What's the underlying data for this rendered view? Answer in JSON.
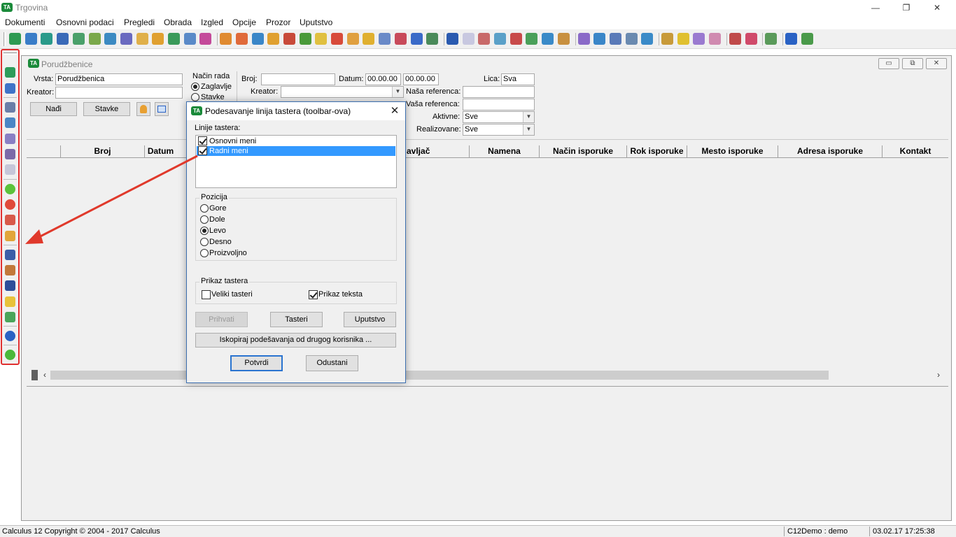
{
  "app": {
    "title": "Trgovina",
    "icon_text": "TA",
    "window_controls": {
      "minimize": "—",
      "restore": "❐",
      "close": "✕"
    }
  },
  "menu": {
    "items": [
      "Dokumenti",
      "Osnovni podaci",
      "Pregledi",
      "Obrada",
      "Izgled",
      "Opcije",
      "Prozor",
      "Uputstvo"
    ]
  },
  "child_window": {
    "title": "Porudžbenice",
    "controls": {
      "minimize": "▭",
      "restore": "⧉",
      "close": "✕"
    },
    "form": {
      "vrsta_label": "Vrsta:",
      "vrsta_value": "Porudžbenica",
      "kreator_label": "Kreator:",
      "kreator_value": "",
      "nadji_button": "Nađi",
      "stavke_button": "Stavke",
      "nacin_rada_label": "Način rada",
      "zaglavlje_label": "Zaglavlje",
      "stavke_radio_label": "Stavke",
      "broj_label": "Broj:",
      "broj_value": "",
      "datum_label": "Datum:",
      "datum_from": "00.00.00",
      "datum_to": "00.00.00",
      "lica_label": "Lica:",
      "lica_value": "Sva",
      "kreator2_label": "Kreator:",
      "kreator2_value": "",
      "nasa_referenca_label": "Naša referenca:",
      "nasa_referenca_value": "",
      "vasa_referenca_label": "Vaša referenca:",
      "vasa_referenca_value": "",
      "aktivne_label": "Aktivne:",
      "aktivne_value": "Sve",
      "realizovane_label": "Realizovane:",
      "realizovane_value": "Sve"
    },
    "grid": {
      "columns": [
        "Broj",
        "Datum",
        "avljač",
        "Namena",
        "Način isporuke",
        "Rok isporuke",
        "Mesto isporuke",
        "Adresa isporuke",
        "Kontakt"
      ]
    }
  },
  "dialog": {
    "title": "Podesavanje linija tastera (toolbar-ova)",
    "list_label": "Linije tastera:",
    "list_items": [
      {
        "label": "Osnovni meni",
        "checked": true,
        "selected": false
      },
      {
        "label": "Radni meni",
        "checked": true,
        "selected": true
      }
    ],
    "pozicija_label": "Pozicija",
    "positions": [
      {
        "label": "Gore",
        "selected": false
      },
      {
        "label": "Dole",
        "selected": false
      },
      {
        "label": "Levo",
        "selected": true
      },
      {
        "label": "Desno",
        "selected": false
      },
      {
        "label": "Proizvoljno",
        "selected": false
      }
    ],
    "prikaz_label": "Prikaz tastera",
    "veliki_tasteri_label": "Veliki tasteri",
    "veliki_tasteri_checked": false,
    "prikaz_teksta_label": "Prikaz teksta",
    "prikaz_teksta_checked": true,
    "prihvati_button": "Prihvati",
    "tasteri_button": "Tasteri",
    "uputstvo_button": "Uputstvo",
    "kopiraj_button": "Iskopiraj podešavanja od drugog korisnika ...",
    "potvrdi_button": "Potvrdi",
    "odustani_button": "Odustani",
    "close_glyph": "✕"
  },
  "status_bar": {
    "left": "Calculus 12  Copyright © 2004 - 2017  Calculus",
    "user": "C12Demo : demo",
    "datetime": "03.02.17 17:25:38"
  },
  "colors": {
    "highlight": "#e03030",
    "selection": "#3399ff",
    "brand": "#1a8a3a"
  }
}
